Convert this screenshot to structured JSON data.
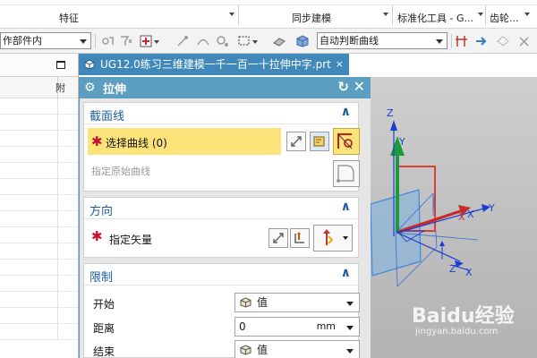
{
  "ribbon": {
    "groups": [
      {
        "label": "特征"
      },
      {
        "label": "同步建模"
      },
      {
        "label": "标准化工具 - G..."
      },
      {
        "label": "齿轮..."
      }
    ]
  },
  "toolbar": {
    "assembly_filter": "作部件内",
    "curve_rule": "自动判断曲线"
  },
  "document": {
    "tab_title": "UG12.0练习三维建模一千一百一十拉伸中字.prt",
    "close_label": "×"
  },
  "navigator": {
    "column_header": "附"
  },
  "dialog": {
    "title": "拉伸",
    "sections": {
      "section_curve": {
        "title": "截面线",
        "select_curve_label": "选择曲线 (0)",
        "specify_original_label": "指定原始曲线"
      },
      "direction": {
        "title": "方向",
        "specify_vector_label": "指定矢量"
      },
      "limits": {
        "title": "限制",
        "start_label": "开始",
        "start_value": "值",
        "distance_label": "距离",
        "distance_value": "0",
        "distance_unit": "mm",
        "end_label": "结束",
        "end_value": "值"
      }
    }
  },
  "viewport": {
    "axes": {
      "y": "Y",
      "x": "X",
      "z": "Z"
    }
  },
  "watermark": {
    "main": "Baidu经验",
    "sub": "jingyan.baidu.com"
  },
  "colors": {
    "dialog_titlebar": "#5c9ebf",
    "doc_tab": "#3f88b9",
    "section_title": "#1c5fa0",
    "highlight": "#fde47a",
    "required": "#c8102e"
  }
}
